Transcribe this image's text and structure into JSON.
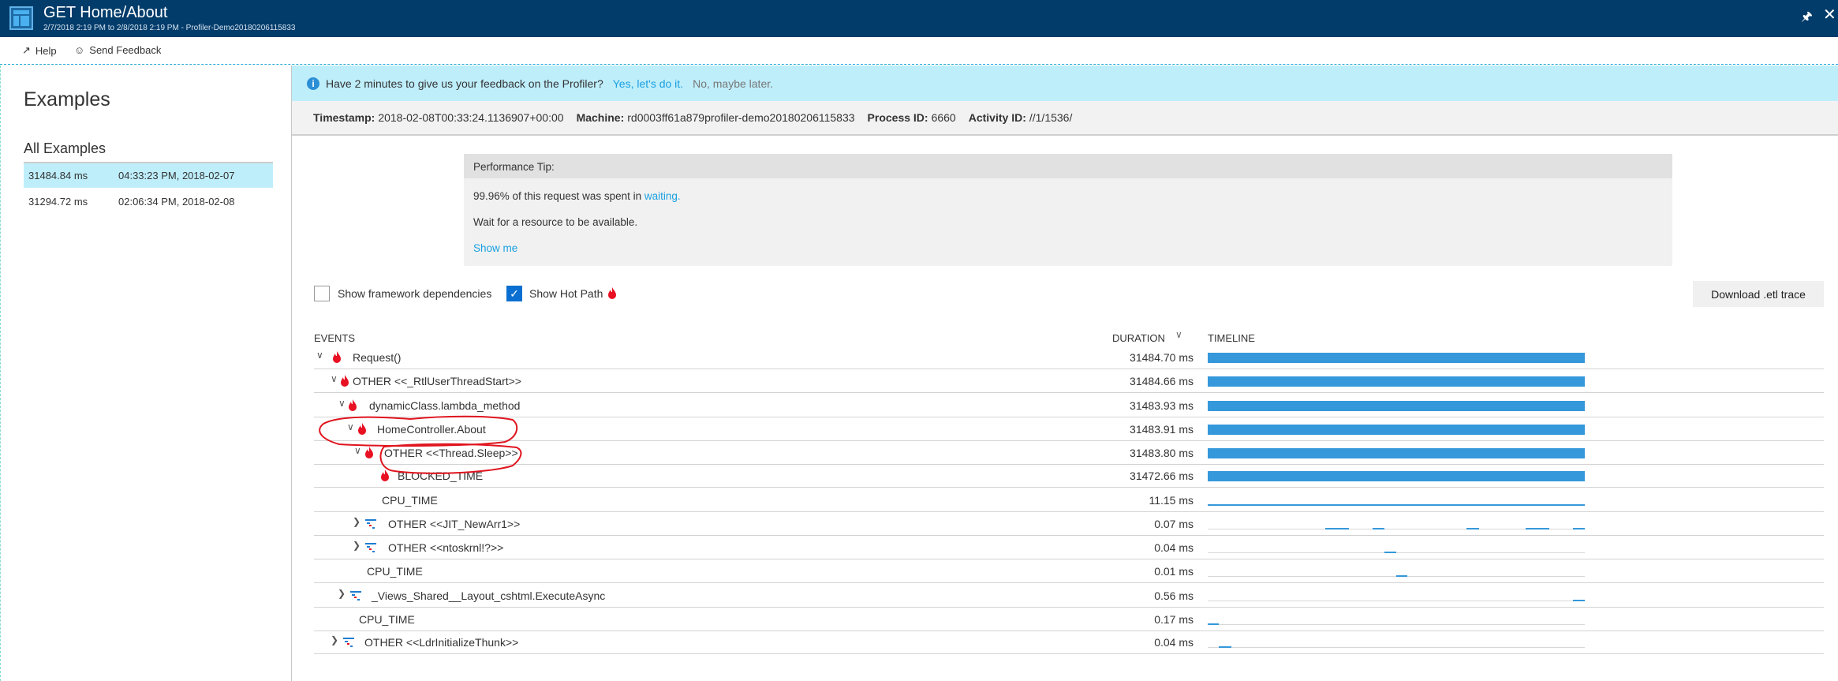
{
  "window": {
    "title": "GET Home/About",
    "subtitle": "2/7/2018 2:19 PM to 2/8/2018 2:19 PM - Profiler-Demo20180206115833",
    "pin_icon": "pin-icon",
    "close_icon": "close-icon"
  },
  "toolbar": {
    "help": "Help",
    "feedback": "Send Feedback"
  },
  "sidebar": {
    "title": "Examples",
    "section": "All Examples",
    "examples": [
      {
        "duration": "31484.84 ms",
        "time": "04:33:23 PM, 2018-02-07",
        "selected": true
      },
      {
        "duration": "31294.72 ms",
        "time": "02:06:34 PM, 2018-02-08",
        "selected": false
      }
    ]
  },
  "feedback_bar": {
    "text": "Have 2 minutes to give us your feedback on the Profiler?",
    "yes": "Yes, let's do it.",
    "no": "No, maybe later."
  },
  "info": {
    "timestamp_label": "Timestamp:",
    "timestamp": "2018-02-08T00:33:24.1136907+00:00",
    "machine_label": "Machine:",
    "machine": "rd0003ff61a879profiler-demo20180206115833",
    "process_label": "Process ID:",
    "process": "6660",
    "activity_label": "Activity ID:",
    "activity": "//1/1536/"
  },
  "tip": {
    "title": "Performance Tip:",
    "line1": "99.96% of this request was spent in",
    "line1_link": "waiting.",
    "line2": "Wait for a resource to be available.",
    "show_me": "Show me"
  },
  "options": {
    "framework_deps": "Show framework dependencies",
    "framework_deps_checked": false,
    "hot_path": "Show Hot Path",
    "hot_path_checked": true,
    "download": "Download .etl trace"
  },
  "table": {
    "headers": {
      "events": "EVENTS",
      "duration": "DURATION",
      "timeline": "TIMELINE"
    },
    "colors": {
      "bar": "#3598db",
      "flame": "#e81123"
    },
    "rows": [
      {
        "name": "Request()",
        "duration": "31484.70 ms",
        "expander": "expanded",
        "icon": "flame",
        "timeline": [
          [
            0,
            1
          ]
        ]
      },
      {
        "name": "OTHER <<_RtlUserThreadStart>>",
        "duration": "31484.66 ms",
        "expander": "expanded",
        "icon": "flame",
        "timeline": [
          [
            0,
            1
          ]
        ]
      },
      {
        "name": "dynamicClass.lambda_method",
        "duration": "31483.93 ms",
        "expander": "expanded",
        "icon": "flame",
        "timeline": [
          [
            0,
            1
          ]
        ]
      },
      {
        "name": "HomeController.About",
        "duration": "31483.91 ms",
        "expander": "expanded",
        "icon": "flame",
        "timeline": [
          [
            0,
            1
          ]
        ]
      },
      {
        "name": "OTHER <<Thread.Sleep>>",
        "duration": "31483.80 ms",
        "expander": "expanded",
        "icon": "flame",
        "timeline": [
          [
            0,
            1
          ]
        ]
      },
      {
        "name": "BLOCKED_TIME",
        "duration": "31472.66 ms",
        "expander": "none",
        "icon": "flame",
        "timeline": [
          [
            0,
            1
          ]
        ]
      },
      {
        "name": "CPU_TIME",
        "duration": "11.15 ms",
        "expander": "none",
        "icon": "none",
        "timeline": [
          [
            0,
            1
          ]
        ],
        "thin": true
      },
      {
        "name": "OTHER <<JIT_NewArr1>>",
        "duration": "0.07 ms",
        "expander": "collapsed",
        "icon": "calltree",
        "timeline": [
          [
            0.312,
            0.375
          ],
          [
            0.437,
            0.469
          ],
          [
            0.687,
            0.719
          ],
          [
            0.843,
            0.906
          ],
          [
            0.968,
            1
          ]
        ]
      },
      {
        "name": "OTHER <<ntoskrnl!?>>",
        "duration": "0.04 ms",
        "expander": "collapsed",
        "icon": "calltree",
        "timeline": [
          [
            0.469,
            0.5
          ]
        ]
      },
      {
        "name": "CPU_TIME",
        "duration": "0.01 ms",
        "expander": "none",
        "icon": "none",
        "timeline": [
          [
            0.5,
            0.53
          ]
        ]
      },
      {
        "name": "_Views_Shared__Layout_cshtml.ExecuteAsync",
        "duration": "0.56 ms",
        "expander": "collapsed",
        "icon": "calltree",
        "timeline": [
          [
            0.968,
            1
          ]
        ]
      },
      {
        "name": "CPU_TIME",
        "duration": "0.17 ms",
        "expander": "none",
        "icon": "none",
        "timeline": [
          [
            0,
            0.03
          ]
        ]
      },
      {
        "name": "OTHER <<LdrInitializeThunk>>",
        "duration": "0.04 ms",
        "expander": "collapsed",
        "icon": "calltree",
        "timeline": [
          [
            0.03,
            0.062
          ]
        ]
      }
    ]
  }
}
